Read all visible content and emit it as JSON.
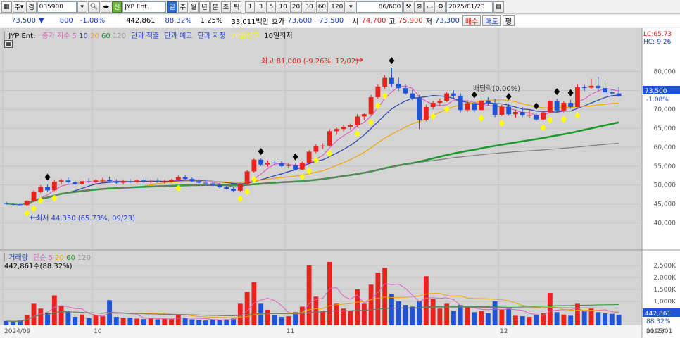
{
  "toolbar": {
    "market_label": "주",
    "search_label": "검",
    "stock_code": "035900",
    "stock_badge": "신",
    "stock_name": "JYP Ent.",
    "periods": [
      "일",
      "주",
      "월",
      "년",
      "분",
      "초",
      "틱"
    ],
    "intervals": [
      "1",
      "3",
      "5",
      "10",
      "20",
      "30",
      "60",
      "120"
    ],
    "page_count": "86",
    "page_total": "/600",
    "date": "2025/01/23"
  },
  "quote": {
    "price": "73,500",
    "direction_arrow": "▼",
    "change": "800",
    "change_pct": "-1.08%",
    "volume": "442,861",
    "volume_ratio": "88.32%",
    "turnover_rate": "1.25%",
    "amount": "33,011백만",
    "ask_label": "호가",
    "ask1": "73,600",
    "ask2": "73,500",
    "open_label": "시",
    "open": "74,700",
    "high_label": "고",
    "high": "75,900",
    "low_label": "저",
    "low": "73,300",
    "buy_label": "매수",
    "sell_label": "매도",
    "eval_label": "평"
  },
  "price_legend": {
    "name": "JYP Ent.",
    "ma_title": "종가 지수",
    "ma_periods": [
      "5",
      "10",
      "20",
      "60",
      "120"
    ],
    "items": [
      "단과 적출",
      "단과 예고",
      "단과 지정"
    ],
    "highlight": "20일신고",
    "last": "10일최저"
  },
  "volume_legend": {
    "title": "거래량",
    "ma_title": "단순",
    "ma_periods": [
      "5",
      "20",
      "60",
      "120"
    ],
    "current": "442,861주(88.32%)"
  },
  "right_info": {
    "lc": "LC:65.73",
    "hc": "HC:-9.26",
    "price_tag": "73,500",
    "pct_tag": "-1.08%",
    "volume_tag": "442,861",
    "volume_pct_tag": "88.32%"
  },
  "annotations": {
    "high_text": "최고 81,000 (-9.26%, 12/02)",
    "low_text": "최저 44,350 (65.73%, 09/23)",
    "mid_text": "배당락(0.00%)"
  },
  "colors": {
    "up": "#e8231e",
    "down": "#1f54d6",
    "ma5": "#e060c0",
    "ma10": "#2a3fb0",
    "ma20": "#f0a500",
    "ma60": "#1a9a2a",
    "ma120": "#7a7a7a",
    "signal_yellow": "#ffff00",
    "signal_black": "#000000"
  },
  "chart_data": {
    "type": "candlestick",
    "price_axis": {
      "ticks": [
        "80,000",
        "75,000",
        "70,000",
        "65,000",
        "60,000",
        "55,000",
        "50,000",
        "45,000",
        "40,000"
      ],
      "ylim": [
        36000,
        82500
      ]
    },
    "volume_axis": {
      "ticks": [
        "2,500K",
        "2,000K",
        "1,500K",
        "1,000K"
      ],
      "ylim": [
        0,
        3000000
      ]
    },
    "x_labels": [
      "2024/09",
      "10",
      "11",
      "12",
      "2025/01",
      "01/23"
    ],
    "x_label_index": [
      0,
      13,
      41,
      72,
      101,
      124
    ],
    "candles": [
      {
        "o": 45200,
        "h": 45600,
        "l": 44800,
        "c": 45100,
        "v": 180000
      },
      {
        "o": 45000,
        "h": 45300,
        "l": 44600,
        "c": 44900,
        "v": 150000
      },
      {
        "o": 44900,
        "h": 45200,
        "l": 44350,
        "c": 44700,
        "v": 200000
      },
      {
        "o": 44700,
        "h": 46000,
        "l": 44400,
        "c": 45800,
        "v": 420000
      },
      {
        "o": 45800,
        "h": 48600,
        "l": 45600,
        "c": 48300,
        "v": 900000
      },
      {
        "o": 48200,
        "h": 50000,
        "l": 47800,
        "c": 49500,
        "v": 700000
      },
      {
        "o": 49500,
        "h": 50200,
        "l": 48200,
        "c": 48600,
        "v": 500000
      },
      {
        "o": 48600,
        "h": 51300,
        "l": 48400,
        "c": 50900,
        "v": 1250000
      },
      {
        "o": 50900,
        "h": 51600,
        "l": 50300,
        "c": 51200,
        "v": 800000
      },
      {
        "o": 51200,
        "h": 52000,
        "l": 50400,
        "c": 50700,
        "v": 600000
      },
      {
        "o": 50700,
        "h": 51200,
        "l": 49900,
        "c": 50300,
        "v": 350000
      },
      {
        "o": 50300,
        "h": 51500,
        "l": 50000,
        "c": 51000,
        "v": 450000
      },
      {
        "o": 51000,
        "h": 51800,
        "l": 50500,
        "c": 50800,
        "v": 300000
      },
      {
        "o": 50800,
        "h": 51500,
        "l": 50200,
        "c": 51200,
        "v": 420000
      },
      {
        "o": 51200,
        "h": 51900,
        "l": 50700,
        "c": 51300,
        "v": 380000
      },
      {
        "o": 51300,
        "h": 52200,
        "l": 50600,
        "c": 51000,
        "v": 1050000
      },
      {
        "o": 51000,
        "h": 51500,
        "l": 50300,
        "c": 50600,
        "v": 350000
      },
      {
        "o": 50600,
        "h": 51300,
        "l": 50200,
        "c": 51000,
        "v": 300000
      },
      {
        "o": 51000,
        "h": 51600,
        "l": 50500,
        "c": 50800,
        "v": 320000
      },
      {
        "o": 50800,
        "h": 51500,
        "l": 50400,
        "c": 51200,
        "v": 280000
      },
      {
        "o": 51200,
        "h": 51700,
        "l": 50600,
        "c": 50900,
        "v": 260000
      },
      {
        "o": 50900,
        "h": 51400,
        "l": 50400,
        "c": 51100,
        "v": 300000
      },
      {
        "o": 51100,
        "h": 51700,
        "l": 50600,
        "c": 50800,
        "v": 250000
      },
      {
        "o": 50800,
        "h": 51400,
        "l": 50300,
        "c": 51000,
        "v": 280000
      },
      {
        "o": 51000,
        "h": 51600,
        "l": 50600,
        "c": 51300,
        "v": 260000
      },
      {
        "o": 51300,
        "h": 52500,
        "l": 51000,
        "c": 52100,
        "v": 420000
      },
      {
        "o": 52100,
        "h": 52600,
        "l": 51300,
        "c": 51600,
        "v": 300000
      },
      {
        "o": 51600,
        "h": 52000,
        "l": 50800,
        "c": 51000,
        "v": 250000
      },
      {
        "o": 51000,
        "h": 51500,
        "l": 50200,
        "c": 50600,
        "v": 220000
      },
      {
        "o": 50600,
        "h": 51200,
        "l": 49800,
        "c": 50400,
        "v": 200000
      },
      {
        "o": 50400,
        "h": 50900,
        "l": 49700,
        "c": 50000,
        "v": 240000
      },
      {
        "o": 50000,
        "h": 50600,
        "l": 49100,
        "c": 49400,
        "v": 220000
      },
      {
        "o": 49400,
        "h": 49800,
        "l": 48800,
        "c": 49000,
        "v": 250000
      },
      {
        "o": 49000,
        "h": 49500,
        "l": 48200,
        "c": 48500,
        "v": 280000
      },
      {
        "o": 48500,
        "h": 50500,
        "l": 48200,
        "c": 50300,
        "v": 900000
      },
      {
        "o": 50300,
        "h": 54000,
        "l": 50100,
        "c": 53600,
        "v": 1400000
      },
      {
        "o": 53600,
        "h": 57000,
        "l": 53300,
        "c": 56700,
        "v": 1800000
      },
      {
        "o": 56700,
        "h": 57000,
        "l": 55000,
        "c": 55400,
        "v": 900000
      },
      {
        "o": 55400,
        "h": 56500,
        "l": 54800,
        "c": 55900,
        "v": 650000
      },
      {
        "o": 55900,
        "h": 56400,
        "l": 55100,
        "c": 55700,
        "v": 420000
      },
      {
        "o": 55700,
        "h": 56300,
        "l": 54700,
        "c": 55000,
        "v": 350000
      },
      {
        "o": 55000,
        "h": 55800,
        "l": 54400,
        "c": 55200,
        "v": 380000
      },
      {
        "o": 55200,
        "h": 55600,
        "l": 53800,
        "c": 54100,
        "v": 550000
      },
      {
        "o": 54100,
        "h": 56200,
        "l": 54000,
        "c": 55800,
        "v": 780000
      },
      {
        "o": 55800,
        "h": 59200,
        "l": 55600,
        "c": 58800,
        "v": 2500000
      },
      {
        "o": 58800,
        "h": 60800,
        "l": 58400,
        "c": 60200,
        "v": 1200000
      },
      {
        "o": 60200,
        "h": 61000,
        "l": 59500,
        "c": 60400,
        "v": 600000
      },
      {
        "o": 60400,
        "h": 64800,
        "l": 60200,
        "c": 64200,
        "v": 2650000
      },
      {
        "o": 64200,
        "h": 65200,
        "l": 63300,
        "c": 64800,
        "v": 900000
      },
      {
        "o": 64800,
        "h": 65900,
        "l": 64200,
        "c": 65400,
        "v": 700000
      },
      {
        "o": 65400,
        "h": 66200,
        "l": 64700,
        "c": 65800,
        "v": 600000
      },
      {
        "o": 65800,
        "h": 68700,
        "l": 65400,
        "c": 68100,
        "v": 1500000
      },
      {
        "o": 68100,
        "h": 69000,
        "l": 67200,
        "c": 68700,
        "v": 900000
      },
      {
        "o": 68700,
        "h": 73800,
        "l": 68400,
        "c": 73200,
        "v": 1700000
      },
      {
        "o": 73200,
        "h": 76500,
        "l": 72800,
        "c": 76000,
        "v": 2200000
      },
      {
        "o": 76000,
        "h": 79000,
        "l": 75400,
        "c": 78300,
        "v": 2400000
      },
      {
        "o": 78300,
        "h": 81000,
        "l": 75900,
        "c": 76600,
        "v": 1300000
      },
      {
        "o": 76600,
        "h": 78400,
        "l": 74800,
        "c": 75600,
        "v": 1000000
      },
      {
        "o": 75600,
        "h": 76500,
        "l": 73800,
        "c": 74200,
        "v": 850000
      },
      {
        "o": 74200,
        "h": 75200,
        "l": 72400,
        "c": 73000,
        "v": 780000
      },
      {
        "o": 73000,
        "h": 73800,
        "l": 64800,
        "c": 67200,
        "v": 1000000
      },
      {
        "o": 67200,
        "h": 71200,
        "l": 66800,
        "c": 70600,
        "v": 2050000
      },
      {
        "o": 70600,
        "h": 72300,
        "l": 70000,
        "c": 71700,
        "v": 1100000
      },
      {
        "o": 71700,
        "h": 72800,
        "l": 70800,
        "c": 72200,
        "v": 700000
      },
      {
        "o": 72200,
        "h": 74600,
        "l": 71900,
        "c": 74200,
        "v": 900000
      },
      {
        "o": 74200,
        "h": 75000,
        "l": 73000,
        "c": 73600,
        "v": 600000
      },
      {
        "o": 73600,
        "h": 74200,
        "l": 69200,
        "c": 69800,
        "v": 850000
      },
      {
        "o": 69800,
        "h": 72200,
        "l": 69300,
        "c": 71600,
        "v": 750000
      },
      {
        "o": 71600,
        "h": 72000,
        "l": 69200,
        "c": 69800,
        "v": 550000
      },
      {
        "o": 69800,
        "h": 73000,
        "l": 69500,
        "c": 72300,
        "v": 600000
      },
      {
        "o": 72300,
        "h": 73200,
        "l": 71000,
        "c": 71600,
        "v": 500000
      },
      {
        "o": 71600,
        "h": 72800,
        "l": 67900,
        "c": 68500,
        "v": 1000000
      },
      {
        "o": 68500,
        "h": 71200,
        "l": 68200,
        "c": 70700,
        "v": 650000
      },
      {
        "o": 70700,
        "h": 71500,
        "l": 68300,
        "c": 68700,
        "v": 700000
      },
      {
        "o": 68700,
        "h": 69900,
        "l": 67800,
        "c": 69300,
        "v": 400000
      },
      {
        "o": 69300,
        "h": 70600,
        "l": 68000,
        "c": 68400,
        "v": 380000
      },
      {
        "o": 68400,
        "h": 69800,
        "l": 67700,
        "c": 68500,
        "v": 350000
      },
      {
        "o": 68500,
        "h": 69000,
        "l": 66900,
        "c": 67300,
        "v": 420000
      },
      {
        "o": 67300,
        "h": 69600,
        "l": 67000,
        "c": 69200,
        "v": 500000
      },
      {
        "o": 69200,
        "h": 72600,
        "l": 69000,
        "c": 72100,
        "v": 1350000
      },
      {
        "o": 72100,
        "h": 72800,
        "l": 69200,
        "c": 69700,
        "v": 550000
      },
      {
        "o": 69700,
        "h": 72100,
        "l": 69200,
        "c": 71700,
        "v": 450000
      },
      {
        "o": 71700,
        "h": 72500,
        "l": 70200,
        "c": 70600,
        "v": 400000
      },
      {
        "o": 70600,
        "h": 76500,
        "l": 70200,
        "c": 75800,
        "v": 900000
      },
      {
        "o": 75800,
        "h": 76400,
        "l": 74800,
        "c": 75700,
        "v": 600000
      },
      {
        "o": 75700,
        "h": 78100,
        "l": 75300,
        "c": 76200,
        "v": 700000
      },
      {
        "o": 76200,
        "h": 78600,
        "l": 74900,
        "c": 75600,
        "v": 550000
      },
      {
        "o": 75600,
        "h": 76900,
        "l": 74100,
        "c": 74500,
        "v": 500000
      },
      {
        "o": 74500,
        "h": 75200,
        "l": 73300,
        "c": 74200,
        "v": 480000
      },
      {
        "o": 74200,
        "h": 75900,
        "l": 73300,
        "c": 73500,
        "v": 442861
      }
    ]
  }
}
